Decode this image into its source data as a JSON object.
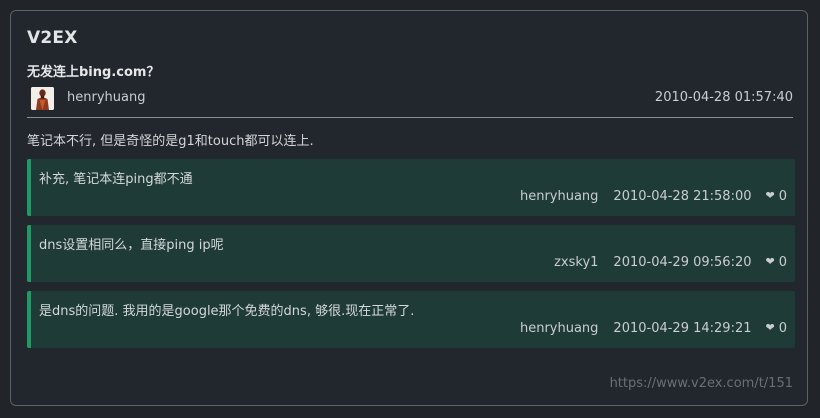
{
  "site": {
    "title": "V2EX"
  },
  "topic": {
    "title": "无发连上bing.com？",
    "author": "henryhuang",
    "time": "2010-04-28 01:57:40",
    "content": "笔记本不行, 但是奇怪的是g1和touch都可以连上."
  },
  "replies": [
    {
      "text": "补充, 笔记本连ping都不通",
      "author": "henryhuang",
      "time": "2010-04-28 21:58:00",
      "likes": "0"
    },
    {
      "text": "dns设置相同么，直接ping ip呢",
      "author": "zxsky1",
      "time": "2010-04-29 09:56:20",
      "likes": "0"
    },
    {
      "text": "是dns的问题. 我用的是google那个免费的dns, 够很.现在正常了.",
      "author": "henryhuang",
      "time": "2010-04-29 14:29:21",
      "likes": "0"
    }
  ],
  "footer": {
    "url": "https://www.v2ex.com/t/151"
  },
  "icons": {
    "like": "heart-icon",
    "avatar": "avatar-image"
  },
  "colors": {
    "background": "#212529",
    "card_border": "#5b6168",
    "reply_background": "#1f3b38",
    "reply_accent": "#1f9a62"
  }
}
